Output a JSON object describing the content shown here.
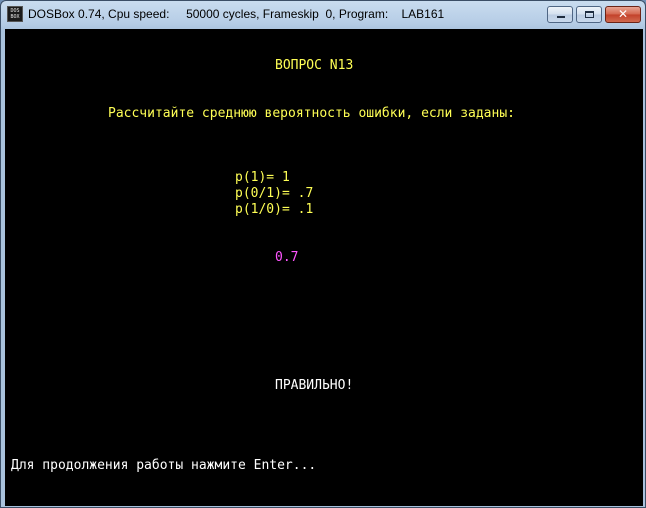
{
  "window": {
    "title": "DOSBox 0.74, Cpu speed:     50000 cycles, Frameskip  0, Program:    LAB161",
    "icon_text_top": "DOS",
    "icon_text_bottom": "BOX",
    "icon": "dosbox-app-icon",
    "buttons": {
      "minimize": "minimize-icon",
      "maximize": "maximize-icon",
      "close_glyph": "✕"
    }
  },
  "screen": {
    "question_title": "ВОПРОС N13",
    "question_text": "Рассчитайте среднюю вероятность ошибки, если заданы:",
    "params": [
      "p(1)= 1",
      "p(0/1)= .7",
      "p(1/0)= .1"
    ],
    "answer": "0.7",
    "result": "ПРАВИЛЬНО!",
    "prompt": "Для продолжения работы нажмите Enter..."
  },
  "colors": {
    "text_yellow": "#ffff55",
    "text_magenta": "#ff55ff",
    "text_white": "#ffffff",
    "background": "#000000"
  }
}
